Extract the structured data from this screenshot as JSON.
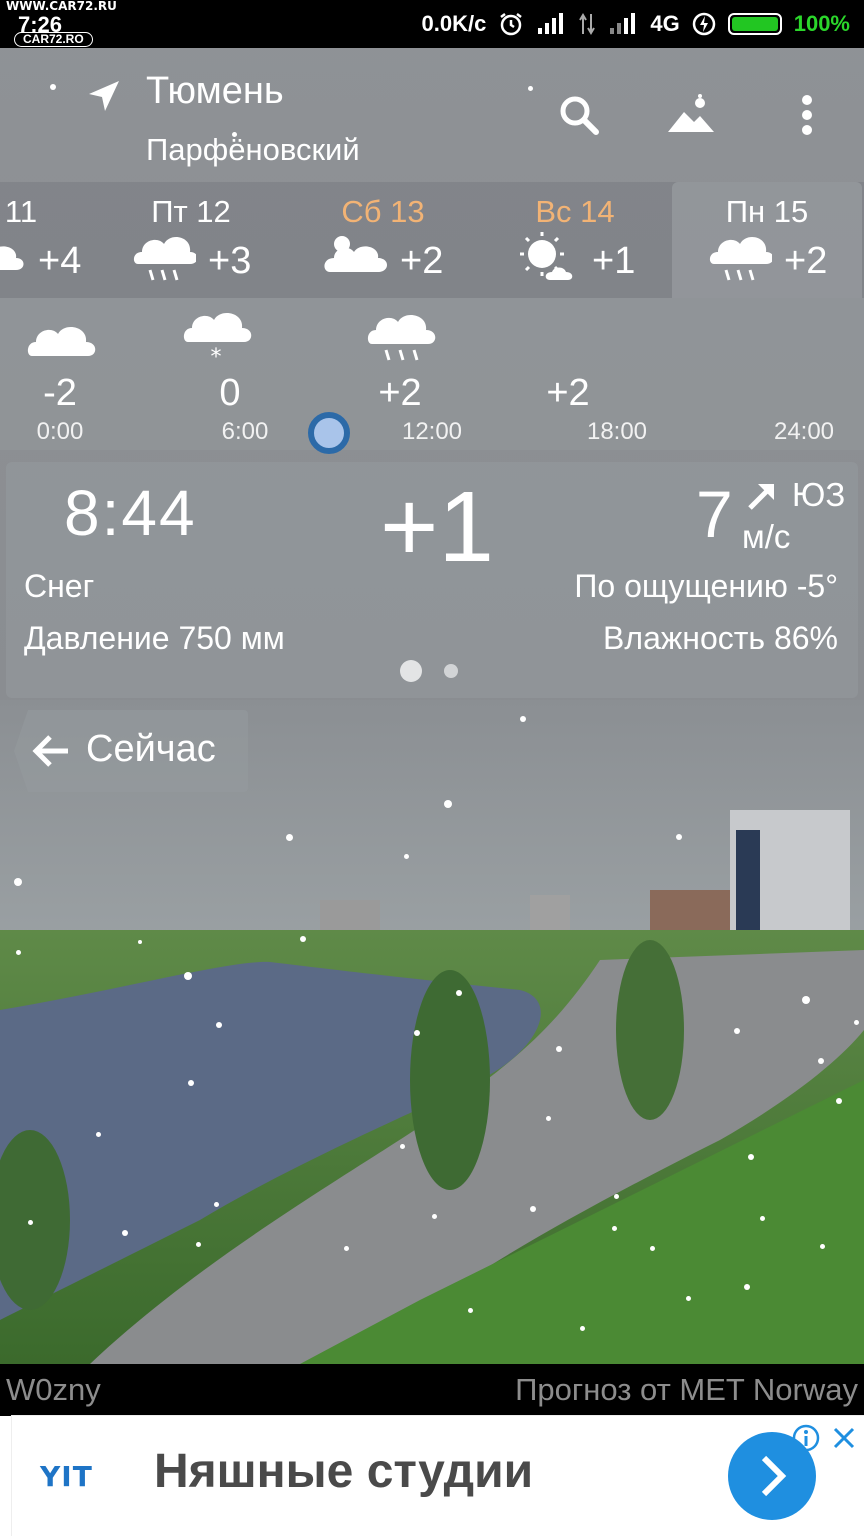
{
  "status_bar": {
    "watermark": "WWW.CAR72.RU",
    "time": "7:26",
    "watermark_logo": "CAR72.RO",
    "network_speed": "0.0K/c",
    "network_type": "4G",
    "battery": "100%",
    "icons": [
      "alarm-icon",
      "signal-icon",
      "data-icon",
      "signal-icon",
      "charging-icon",
      "battery-icon"
    ]
  },
  "header": {
    "city": "Тюмень",
    "district": "Парфёновский",
    "icons": [
      "location-arrow-icon",
      "search-icon",
      "background-image-icon",
      "more-vert-icon"
    ]
  },
  "days": [
    {
      "label": "11",
      "temp": "+4",
      "icon": "partly-cloudy-icon",
      "orange": false,
      "selected": false
    },
    {
      "label": "Пт 12",
      "temp": "+3",
      "icon": "rain-icon",
      "orange": false,
      "selected": false
    },
    {
      "label": "Сб 13",
      "temp": "+2",
      "icon": "sun-cloud-icon",
      "orange": true,
      "selected": false
    },
    {
      "label": "Вс 14",
      "temp": "+1",
      "icon": "sun-small-cloud-icon",
      "orange": true,
      "selected": false
    },
    {
      "label": "Пн 15",
      "temp": "+2",
      "icon": "rain-icon",
      "orange": false,
      "selected": true
    }
  ],
  "hourly": {
    "temps": [
      "-2",
      "0",
      "+2",
      "+2"
    ],
    "icons": [
      "cloud-icon",
      "snow-cloud-icon",
      "rain-cloud-icon"
    ],
    "labels": [
      "0:00",
      "6:00",
      "12:00",
      "18:00",
      "24:00"
    ],
    "timeline_position": 0.32
  },
  "current": {
    "time": "8:44",
    "temp": "+1",
    "wind_speed": "7",
    "wind_unit": "м/с",
    "wind_dir": "ЮЗ",
    "condition": "Снег",
    "feels_like": "По ощущению -5°",
    "pressure": "Давление 750 мм",
    "humidity": "Влажность 86%",
    "page_count": 2,
    "active_page": 1
  },
  "now_button": {
    "label": "Сейчас"
  },
  "footer": {
    "left": "W0zny",
    "right": "Прогноз от MET Norway"
  },
  "ad": {
    "logo": "YIT",
    "title": "Няшные студии"
  },
  "colors": {
    "accent_orange": "#f2b375",
    "battery_green": "#22c622",
    "timeline_dot": "#2c6aa8",
    "ad_button": "#1f8fe0"
  }
}
